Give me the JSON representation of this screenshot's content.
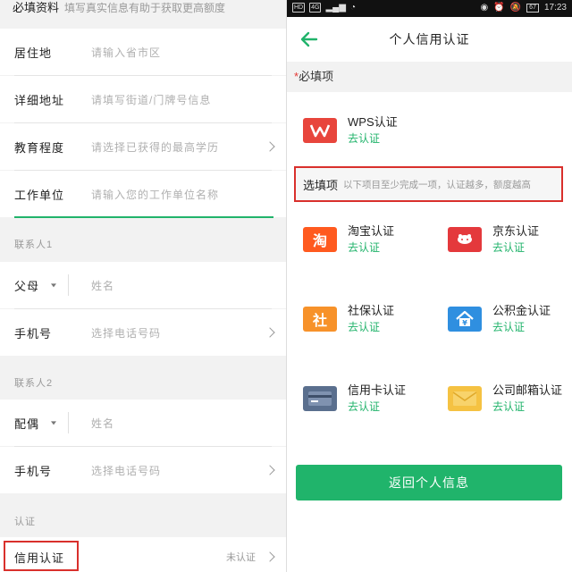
{
  "left": {
    "top_label": "必填资料",
    "top_hint": "填写真实信息有助于获取更高额度",
    "rows": {
      "residence": {
        "label": "居住地",
        "placeholder": "请输入省市区"
      },
      "address": {
        "label": "详细地址",
        "placeholder": "请填写街道/门牌号信息"
      },
      "education": {
        "label": "教育程度",
        "placeholder": "请选择已获得的最高学历"
      },
      "employer": {
        "label": "工作单位",
        "placeholder": "请输入您的工作单位名称"
      }
    },
    "contact1": {
      "section": "联系人1",
      "relation": "父母",
      "name_placeholder": "姓名",
      "phone_label": "手机号",
      "phone_placeholder": "选择电话号码"
    },
    "contact2": {
      "section": "联系人2",
      "relation": "配偶",
      "name_placeholder": "姓名",
      "phone_label": "手机号",
      "phone_placeholder": "选择电话号码"
    },
    "auth": {
      "section": "认证",
      "label": "信用认证",
      "status": "未认证"
    },
    "accent_color": "#21b36b",
    "highlight_color": "#d9302c"
  },
  "status_bar": {
    "left_badges": [
      "HD",
      "4G"
    ],
    "battery": "67",
    "time": "17:23"
  },
  "right": {
    "title": "个人信用认证",
    "required_star": "*",
    "required_label": "必填项",
    "wps": {
      "name": "WPS认证",
      "status": "去认证",
      "icon": "wps-icon",
      "color": "#e8453c"
    },
    "optional_title": "选填项",
    "optional_desc": "以下项目至少完成一项，认证越多，额度越高",
    "items": {
      "taobao": {
        "name": "淘宝认证",
        "status": "去认证",
        "icon": "taobao-icon",
        "glyph": "淘",
        "color": "#ff5a1f"
      },
      "jd": {
        "name": "京东认证",
        "status": "去认证",
        "icon": "jd-icon",
        "color": "#e4393c"
      },
      "social": {
        "name": "社保认证",
        "status": "去认证",
        "icon": "social-security-icon",
        "glyph": "社",
        "color": "#f7922a"
      },
      "fund": {
        "name": "公积金认证",
        "status": "去认证",
        "icon": "housing-fund-icon",
        "color": "#2f8fe0"
      },
      "card": {
        "name": "信用卡认证",
        "status": "去认证",
        "icon": "credit-card-icon",
        "color": "#5a6f8e"
      },
      "email": {
        "name": "公司邮箱认证",
        "status": "去认证",
        "icon": "mail-icon",
        "color": "#f5c242"
      }
    },
    "return_button": "返回个人信息"
  }
}
